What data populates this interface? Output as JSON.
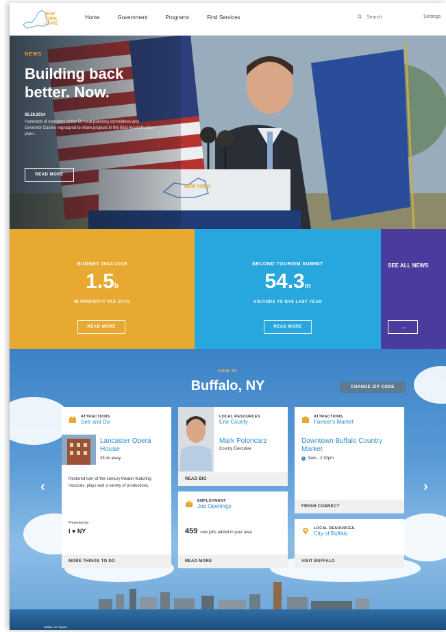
{
  "header": {
    "logo_alt": "New York State",
    "nav": [
      "Home",
      "Government",
      "Programs",
      "Find Services"
    ],
    "search_placeholder": "Search",
    "settings": "Settings"
  },
  "hero": {
    "eyebrow": "NEWS",
    "title": "Building back better. Now.",
    "date": "05.20.2014",
    "text": "Hundreds of members of the 50 local planning committees and Governor Cuomo regrouped to share projects in the final reconstruction plans.",
    "button": "READ MORE",
    "podium_text": "NEW YORK STATE OF OPPORTUNITY"
  },
  "stats": [
    {
      "eyebrow": "BUDGET 2014-2015",
      "value": "1.5",
      "unit": "b",
      "sub": "IN PROPERTY TAX CUTS",
      "button": "READ MORE",
      "color": "#e8a930"
    },
    {
      "eyebrow": "SECOND TOURISM SUMMIT",
      "value": "54.3",
      "unit": "m",
      "sub": "VISITORS TO NYS LAST YEAR",
      "button": "READ MORE",
      "color": "#28a6de"
    }
  ],
  "see_all": {
    "label": "SEE ALL NEWS",
    "arrow": "→",
    "color": "#4a3b9c"
  },
  "local": {
    "eyebrow": "NEW IN",
    "title": "Buffalo, NY",
    "zip_button": "CHANGE ZIP CODE",
    "prev": "‹",
    "next": "›",
    "cards": {
      "attractions": {
        "category": "ATTRACTIONS",
        "sub": "See and Do",
        "link": "Lancaster Opera House",
        "distance": "28 mi away",
        "desc": "Restored turn-of-the-century theater featuring musicals, plays and a variety of productions.",
        "presented": "Presented by",
        "brand": "I ♥ NY",
        "foot": "MORE THINGS TO DO"
      },
      "resources": {
        "category": "LOCAL RESOURCES",
        "sub": "Erie County",
        "link": "Mark Poloncarz",
        "role": "County Executive",
        "foot": "READ BIO"
      },
      "employment": {
        "category": "EMPLOYMENT",
        "sub": "Job Openings",
        "count": "459",
        "count_text": "new jobs added in your area",
        "foot": "READ MORE"
      },
      "market": {
        "category": "ATTRACTIONS",
        "sub": "Farmer's Market",
        "link": "Downtown Buffalo Country Market",
        "time": "8am - 2:30pm",
        "foot": "FRESH CONNECT"
      },
      "city": {
        "category": "LOCAL RESOURCES",
        "sub": "City of Buffalo",
        "foot": "VISIT BUFFALO"
      }
    },
    "caption": "Buffalo, NY Skyline"
  }
}
